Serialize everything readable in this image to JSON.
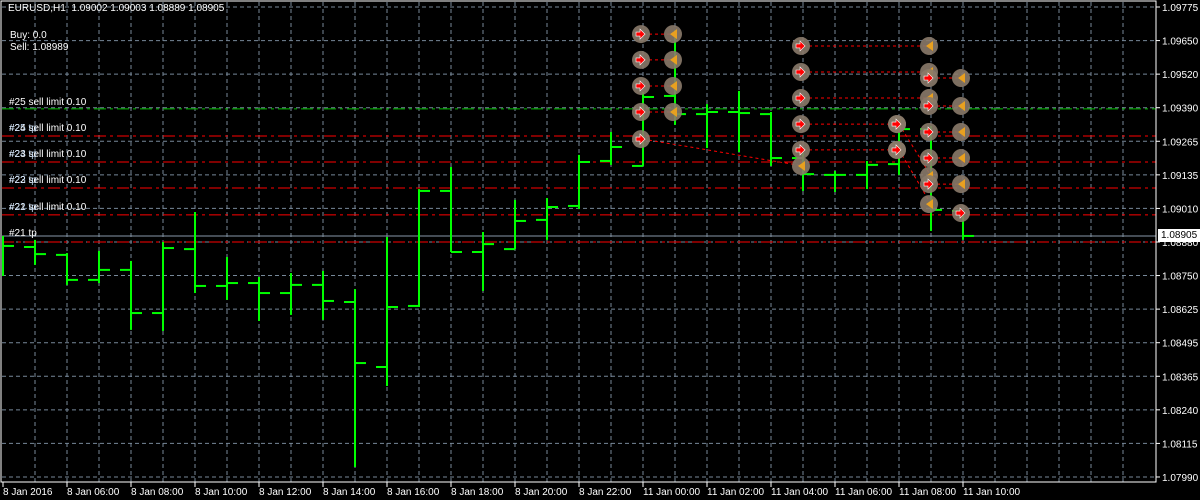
{
  "header": {
    "symbol": "EURUSD,H1",
    "ohlc": "1.09002 1.09003 1.08889 1.08905",
    "buy": "Buy: 0.0",
    "sell": "Sell: 1.08989"
  },
  "current_price": "1.08905",
  "order_labels": [
    {
      "a": "#25 sell limit 0.10",
      "b": ""
    },
    {
      "a": "#24 sell limit 0.10",
      "b": "#25 tp"
    },
    {
      "a": "#23 sell limit 0.10",
      "b": "#24 tp"
    },
    {
      "a": "#22 sell limit 0.10",
      "b": "#23 tp"
    },
    {
      "a": "#21 sell limit 0.10",
      "b": "#22 tp"
    },
    {
      "a": "#21 tp",
      "b": ""
    }
  ],
  "colors": {
    "bar": "#00ff00",
    "grid": "#778899",
    "order_line": "#ff0000",
    "limit_line": "#00c000",
    "bid_line": "#8899aa"
  },
  "chart_data": {
    "type": "ohlc",
    "symbol": "EURUSD",
    "timeframe": "H1",
    "ylim": [
      1.0799,
      1.09775
    ],
    "y_ticks": [
      "1.09775",
      "1.09650",
      "1.09520",
      "1.09390",
      "1.09265",
      "1.09135",
      "1.09010",
      "1.08880",
      "1.08750",
      "1.08625",
      "1.08495",
      "1.08365",
      "1.08240",
      "1.08115",
      "1.07990"
    ],
    "x_ticks": [
      "8 Jan 2016",
      "8 Jan 06:00",
      "8 Jan 08:00",
      "8 Jan 10:00",
      "8 Jan 12:00",
      "8 Jan 14:00",
      "8 Jan 16:00",
      "8 Jan 18:00",
      "8 Jan 20:00",
      "8 Jan 22:00",
      "11 Jan 00:00",
      "11 Jan 02:00",
      "11 Jan 04:00",
      "11 Jan 06:00",
      "11 Jan 08:00",
      "11 Jan 10:00"
    ],
    "bars": [
      [
        1.0889,
        1.08905,
        1.08753,
        1.08867
      ],
      [
        1.08863,
        1.0889,
        1.08795,
        1.08836
      ],
      [
        1.08833,
        1.0884,
        1.08719,
        1.08738
      ],
      [
        1.08738,
        1.08848,
        1.08726,
        1.08776
      ],
      [
        1.08776,
        1.0881,
        1.08548,
        1.08612
      ],
      [
        1.08612,
        1.08882,
        1.08544,
        1.08859
      ],
      [
        1.08855,
        1.08996,
        1.08688,
        1.08715
      ],
      [
        1.08715,
        1.08825,
        1.08662,
        1.08726
      ],
      [
        1.08726,
        1.08749,
        1.08582,
        1.08688
      ],
      [
        1.08688,
        1.08764,
        1.08605,
        1.08719
      ],
      [
        1.08719,
        1.08772,
        1.08586,
        1.08658
      ],
      [
        1.08654,
        1.08703,
        1.08027,
        1.08422
      ],
      [
        1.08407,
        1.08901,
        1.08335,
        1.08635
      ],
      [
        1.08639,
        1.09083,
        1.08635,
        1.09076
      ],
      [
        1.09076,
        1.09167,
        1.08844,
        1.08844
      ],
      [
        1.08844,
        1.0892,
        1.08696,
        1.08874
      ],
      [
        1.08855,
        1.09042,
        1.08855,
        1.08962
      ],
      [
        1.08966,
        1.09049,
        1.0889,
        1.09015
      ],
      [
        1.09019,
        1.09213,
        1.09007,
        1.09186
      ],
      [
        1.0919,
        1.093,
        1.09175,
        1.09243
      ],
      [
        1.09171,
        1.09452,
        1.09171,
        1.09433
      ],
      [
        1.09437,
        1.09688,
        1.09327,
        1.09368
      ],
      [
        1.09368,
        1.09406,
        1.09239,
        1.09376
      ],
      [
        1.09376,
        1.09456,
        1.09224,
        1.09372
      ],
      [
        1.09368,
        1.09376,
        1.09171,
        1.09201
      ],
      [
        1.09201,
        1.0922,
        1.09076,
        1.0914
      ],
      [
        1.09137,
        1.09152,
        1.09072,
        1.09137
      ],
      [
        1.09137,
        1.0919,
        1.09083,
        1.09175
      ],
      [
        1.09178,
        1.09315,
        1.09137,
        1.09311
      ],
      [
        1.09311,
        1.09323,
        1.08924,
        1.09004
      ],
      [
        1.09,
        1.09004,
        1.0889,
        1.08905
      ]
    ],
    "order_lines": [
      {
        "price": 1.09388,
        "kind": "sell-limit"
      },
      {
        "price": 1.09285,
        "kind": "order"
      },
      {
        "price": 1.09186,
        "kind": "order"
      },
      {
        "price": 1.09087,
        "kind": "order"
      },
      {
        "price": 1.08985,
        "kind": "order"
      },
      {
        "price": 1.08882,
        "kind": "order"
      }
    ],
    "bid": 1.08905,
    "trades": [
      {
        "from": [
          20,
          1.09672
        ],
        "to": [
          21,
          1.09672
        ]
      },
      {
        "from": [
          20,
          1.09574
        ],
        "to": [
          21,
          1.09574
        ]
      },
      {
        "from": [
          20,
          1.09475
        ],
        "to": [
          21,
          1.09475
        ]
      },
      {
        "from": [
          20,
          1.09376
        ],
        "to": [
          21,
          1.09376
        ]
      },
      {
        "from": [
          20,
          1.09273
        ],
        "to": [
          25,
          1.09171
        ]
      },
      {
        "from": [
          25,
          1.09627
        ],
        "to": [
          29,
          1.09627
        ]
      },
      {
        "from": [
          25,
          1.09528
        ],
        "to": [
          29,
          1.09528
        ]
      },
      {
        "from": [
          25,
          1.09429
        ],
        "to": [
          29,
          1.09429
        ]
      },
      {
        "from": [
          25,
          1.0933
        ],
        "to": [
          28,
          1.0933
        ]
      },
      {
        "from": [
          25,
          1.09232
        ],
        "to": [
          28,
          1.09232
        ]
      },
      {
        "from": [
          28,
          1.0933
        ],
        "to": [
          29,
          1.09133
        ]
      },
      {
        "from": [
          28,
          1.09232
        ],
        "to": [
          29,
          1.09026
        ]
      },
      {
        "from": [
          29,
          1.09505
        ],
        "to": [
          30,
          1.09505
        ]
      },
      {
        "from": [
          29,
          1.09399
        ],
        "to": [
          30,
          1.09399
        ]
      },
      {
        "from": [
          29,
          1.093
        ],
        "to": [
          30,
          1.093
        ]
      },
      {
        "from": [
          29,
          1.09201
        ],
        "to": [
          30,
          1.09201
        ]
      },
      {
        "from": [
          29,
          1.09102
        ],
        "to": [
          30,
          1.09102
        ]
      },
      {
        "from": [
          30,
          1.08992
        ],
        "to": null
      }
    ]
  }
}
